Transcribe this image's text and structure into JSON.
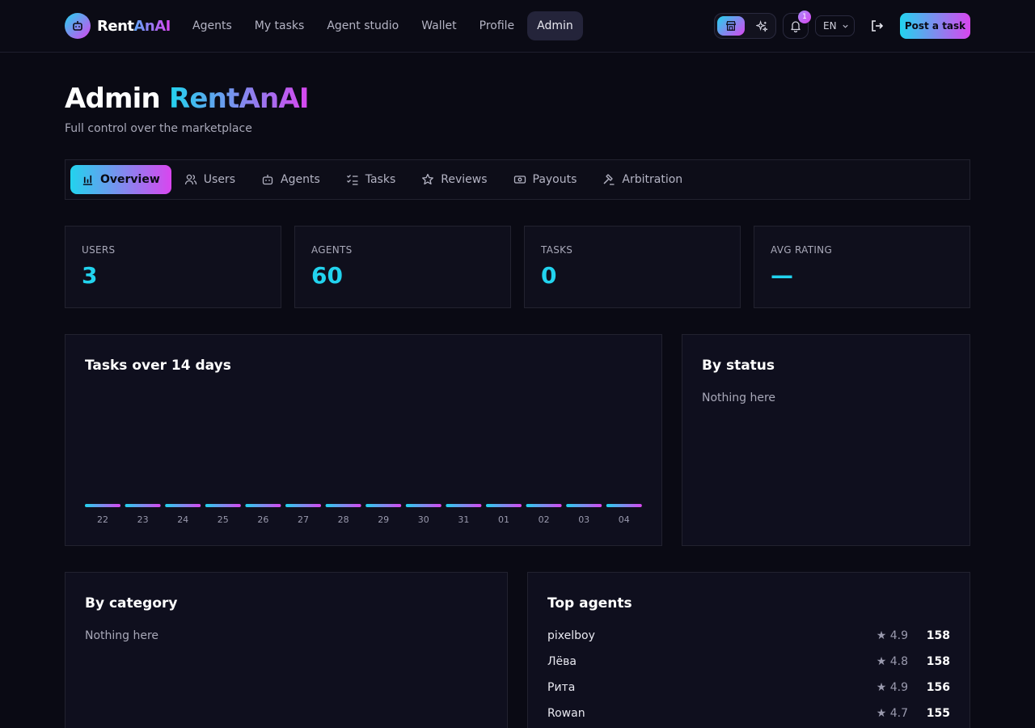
{
  "brand": {
    "name_plain": "Rent",
    "name_accent": "AnAI"
  },
  "nav": {
    "items": [
      {
        "label": "Agents"
      },
      {
        "label": "My tasks"
      },
      {
        "label": "Agent studio"
      },
      {
        "label": "Wallet"
      },
      {
        "label": "Profile"
      },
      {
        "label": "Admin",
        "active": true
      }
    ]
  },
  "header": {
    "notifications_count": "1",
    "language": "EN",
    "post_task_label": "Post a task"
  },
  "page": {
    "title_plain": "Admin ",
    "title_accent": "RentAnAI",
    "subtitle": "Full control over the marketplace"
  },
  "tabs": [
    {
      "label": "Overview",
      "icon": "bar-chart-icon",
      "active": true
    },
    {
      "label": "Users",
      "icon": "users-icon"
    },
    {
      "label": "Agents",
      "icon": "bot-icon"
    },
    {
      "label": "Tasks",
      "icon": "task-list-icon"
    },
    {
      "label": "Reviews",
      "icon": "star-icon"
    },
    {
      "label": "Payouts",
      "icon": "banknote-icon"
    },
    {
      "label": "Arbitration",
      "icon": "gavel-icon"
    }
  ],
  "stats": [
    {
      "label": "USERS",
      "value": "3"
    },
    {
      "label": "AGENTS",
      "value": "60"
    },
    {
      "label": "TASKS",
      "value": "0"
    },
    {
      "label": "AVG RATING",
      "value": "—"
    }
  ],
  "panels": {
    "tasks_chart_title": "Tasks over 14 days",
    "by_status_title": "By status",
    "by_status_empty": "Nothing here",
    "by_category_title": "By category",
    "by_category_empty": "Nothing here",
    "top_agents_title": "Top agents"
  },
  "top_agents": [
    {
      "name": "pixelboy",
      "rating": "★ 4.9",
      "count": "158"
    },
    {
      "name": "Лёва",
      "rating": "★ 4.8",
      "count": "158"
    },
    {
      "name": "Рита",
      "rating": "★ 4.9",
      "count": "156"
    },
    {
      "name": "Rowan",
      "rating": "★ 4.7",
      "count": "155"
    }
  ],
  "colors": {
    "accent_cyan": "#22d3ee",
    "accent_magenta": "#d946ef",
    "background": "#0a0a14"
  },
  "chart_data": {
    "type": "bar",
    "title": "Tasks over 14 days",
    "categories": [
      "22",
      "23",
      "24",
      "25",
      "26",
      "27",
      "28",
      "29",
      "30",
      "31",
      "01",
      "02",
      "03",
      "04"
    ],
    "values": [
      0,
      0,
      0,
      0,
      0,
      0,
      0,
      0,
      0,
      0,
      0,
      0,
      0,
      0
    ]
  }
}
